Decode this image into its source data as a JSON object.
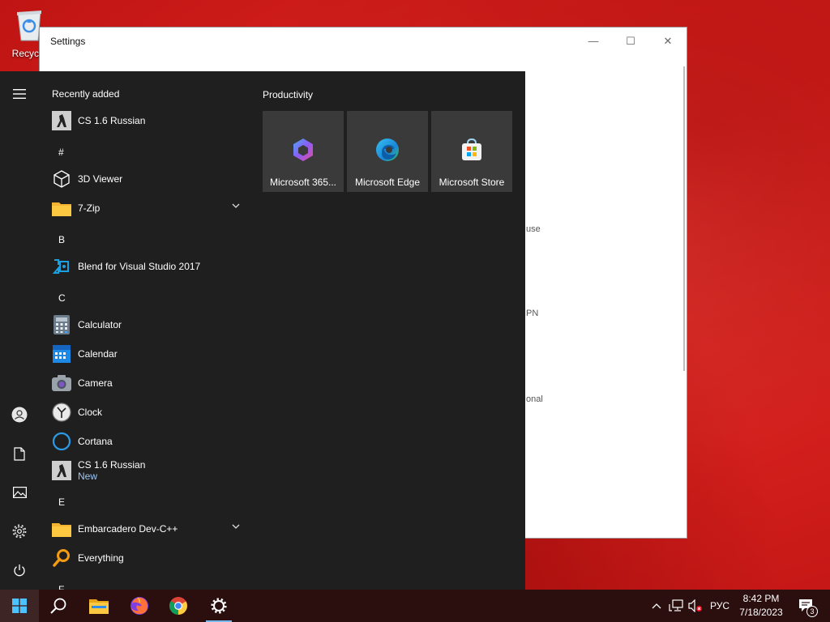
{
  "desktop": {
    "recycle_bin_label": "Recycle"
  },
  "settings_window": {
    "title": "Settings",
    "minimize_glyph": "—",
    "maximize_glyph": "☐",
    "close_glyph": "✕",
    "peek_texts": [
      "use",
      "PN",
      "onal"
    ]
  },
  "start_menu": {
    "rail": {
      "menu_icon": "hamburger-icon",
      "account_icon": "user-icon",
      "documents_icon": "document-icon",
      "pictures_icon": "pictures-icon",
      "settings_icon": "gear-icon",
      "power_icon": "power-icon"
    },
    "recently_added_label": "Recently added",
    "apps": [
      {
        "type": "app",
        "label": "CS 1.6 Russian",
        "icon": "cs-icon"
      },
      {
        "type": "letter",
        "label": "#"
      },
      {
        "type": "app",
        "label": "3D Viewer",
        "icon": "cube-icon"
      },
      {
        "type": "folder",
        "label": "7-Zip",
        "icon": "folder-icon",
        "expandable": true
      },
      {
        "type": "letter",
        "label": "B"
      },
      {
        "type": "app",
        "label": "Blend for Visual Studio 2017",
        "icon": "blend-icon"
      },
      {
        "type": "letter",
        "label": "C"
      },
      {
        "type": "app",
        "label": "Calculator",
        "icon": "calculator-icon"
      },
      {
        "type": "app",
        "label": "Calendar",
        "icon": "calendar-icon"
      },
      {
        "type": "app",
        "label": "Camera",
        "icon": "camera-icon"
      },
      {
        "type": "app",
        "label": "Clock",
        "icon": "clock-icon"
      },
      {
        "type": "app",
        "label": "Cortana",
        "icon": "cortana-icon"
      },
      {
        "type": "app",
        "label": "CS 1.6 Russian",
        "sub": "New",
        "icon": "cs-icon"
      },
      {
        "type": "letter",
        "label": "E"
      },
      {
        "type": "folder",
        "label": "Embarcadero Dev-C++",
        "icon": "folder-icon",
        "expandable": true
      },
      {
        "type": "app",
        "label": "Everything",
        "icon": "everything-icon"
      },
      {
        "type": "letter",
        "label": "F"
      }
    ],
    "tiles_group": "Productivity",
    "tiles": [
      {
        "label": "Microsoft 365...",
        "icon": "microsoft365-icon"
      },
      {
        "label": "Microsoft Edge",
        "icon": "edge-icon"
      },
      {
        "label": "Microsoft Store",
        "icon": "store-icon"
      }
    ]
  },
  "taskbar": {
    "pinned": [
      "start-icon",
      "search-icon",
      "file-explorer-icon",
      "firefox-icon",
      "chrome-icon",
      "settings-icon"
    ],
    "tray": {
      "chevron": "^",
      "language": "РУС",
      "time": "8:42 PM",
      "date": "7/18/2023",
      "notification_count": "3"
    }
  },
  "colors": {
    "start_bg": "#1f1f1f",
    "tile_bg": "#3a3a3a",
    "accent": "#76b9ed",
    "desktop": "#d21f1c"
  }
}
